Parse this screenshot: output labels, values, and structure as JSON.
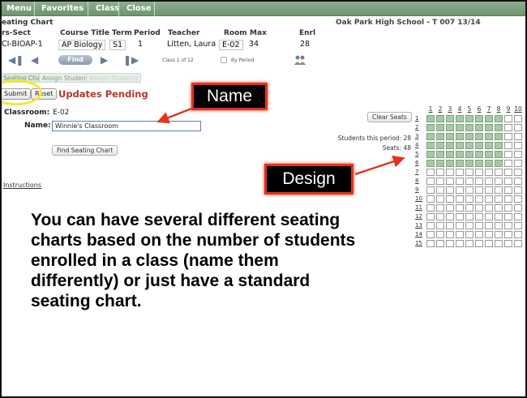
{
  "menu": {
    "items": [
      "Menu",
      "Favorites",
      "Class",
      "Close"
    ]
  },
  "header": {
    "title": "eating Chart",
    "school": "Oak Park High School - T 007 13/14"
  },
  "class_table": {
    "columns": [
      "rs-Sect",
      "Course Title",
      "Term",
      "Period",
      "Teacher",
      "Room",
      "Max",
      "Enrl"
    ],
    "row": [
      "CI-BIOAP-1",
      "AP Biology",
      "S1",
      "1",
      "Litten, Laura",
      "E-02",
      "34",
      "28"
    ]
  },
  "nav": {
    "find_label": "Find",
    "class_count": "Class 1 of 12",
    "by_period": "By Period"
  },
  "tabs": [
    "Seating Chart",
    "Assign Students",
    "Assign Students"
  ],
  "actions": {
    "submit": "Submit",
    "reset": "Reset",
    "pending": "Updates Pending"
  },
  "form": {
    "classroom_label": "Classroom:",
    "classroom_value": "E-02",
    "name_label": "Name:",
    "name_value": "Winnie's Classroom",
    "find_chart": "Find Seating Chart",
    "instructions": "Instructions",
    "clear_seats": "Clear Seats",
    "students_period": "Students this period: 28",
    "seats": "Seats: 48"
  },
  "callouts": {
    "name": "Name",
    "design": "Design"
  },
  "grid": {
    "col_labels": [
      "1",
      "2",
      "3",
      "4",
      "5",
      "6",
      "7",
      "8",
      "9",
      "10"
    ],
    "row_labels": [
      "1",
      "2",
      "3",
      "4",
      "5",
      "6",
      "7",
      "8",
      "9",
      "10",
      "11",
      "12",
      "13",
      "14",
      "15"
    ],
    "filled_rows": 6,
    "filled_cols": 8
  },
  "caption": "You can have several different seating charts based on the number of students enrolled in a class (name them differently) or just have a standard seating chart.",
  "colors": {
    "menubar": "#7a9f7c",
    "callout_border": "#e3341b",
    "highlight_ellipse": "#f2ea2c",
    "pending_text": "#b3362a",
    "seat_filled": "#a8c8a8"
  }
}
